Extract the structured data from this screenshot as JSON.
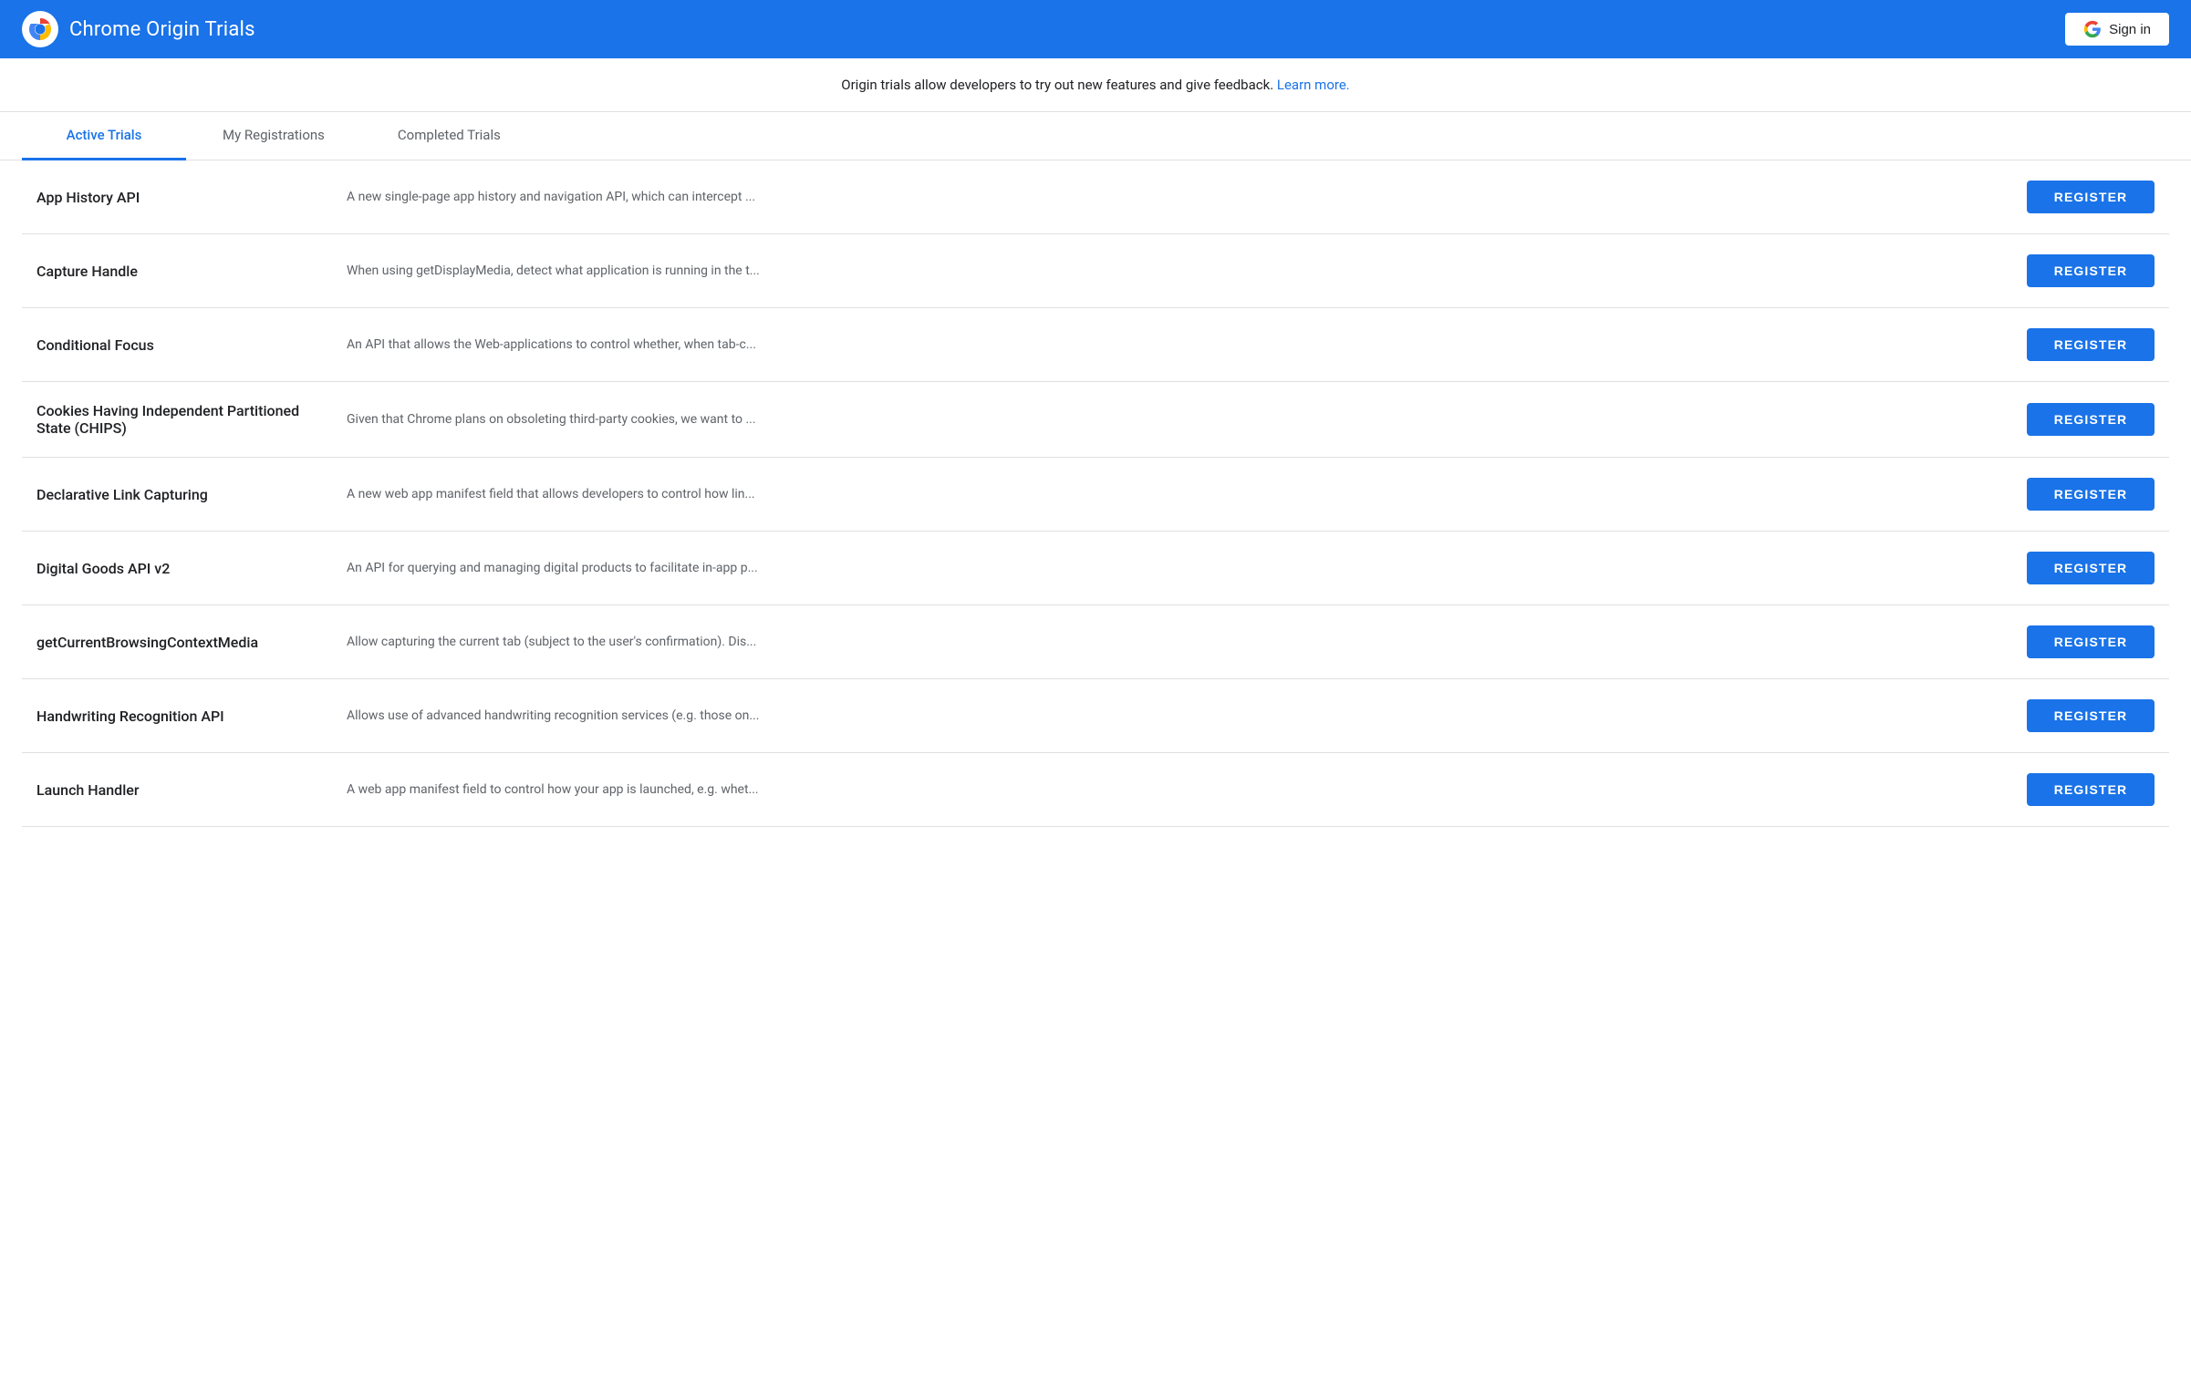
{
  "header": {
    "title": "Chrome Origin Trials",
    "sign_in_label": "Sign in"
  },
  "info_bar": {
    "text": "Origin trials allow developers to try out new features and give feedback.",
    "learn_more_label": "Learn more."
  },
  "tabs": [
    {
      "id": "active",
      "label": "Active Trials",
      "active": true
    },
    {
      "id": "my-registrations",
      "label": "My Registrations",
      "active": false
    },
    {
      "id": "completed",
      "label": "Completed Trials",
      "active": false
    }
  ],
  "trials": [
    {
      "name": "App History API",
      "description": "A new single-page app history and navigation API, which can intercept ...",
      "register_label": "REGISTER"
    },
    {
      "name": "Capture Handle",
      "description": "When using getDisplayMedia, detect what application is running in the t...",
      "register_label": "REGISTER"
    },
    {
      "name": "Conditional Focus",
      "description": "An API that allows the Web-applications to control whether, when tab-c...",
      "register_label": "REGISTER"
    },
    {
      "name": "Cookies Having Independent Partitioned State (CHIPS)",
      "description": "Given that Chrome plans on obsoleting third-party cookies, we want to ...",
      "register_label": "REGISTER"
    },
    {
      "name": "Declarative Link Capturing",
      "description": "A new web app manifest field that allows developers to control how lin...",
      "register_label": "REGISTER"
    },
    {
      "name": "Digital Goods API v2",
      "description": "An API for querying and managing digital products to facilitate in-app p...",
      "register_label": "REGISTER"
    },
    {
      "name": "getCurrentBrowsingContextMedia",
      "description": "Allow capturing the current tab (subject to the user's confirmation). Dis...",
      "register_label": "REGISTER"
    },
    {
      "name": "Handwriting Recognition API",
      "description": "Allows use of advanced handwriting recognition services (e.g. those on...",
      "register_label": "REGISTER"
    },
    {
      "name": "Launch Handler",
      "description": "A web app manifest field to control how your app is launched, e.g. whet...",
      "register_label": "REGISTER"
    }
  ],
  "colors": {
    "primary": "#1a73e8",
    "text_secondary": "#5f6368",
    "divider": "#e0e0e0"
  }
}
